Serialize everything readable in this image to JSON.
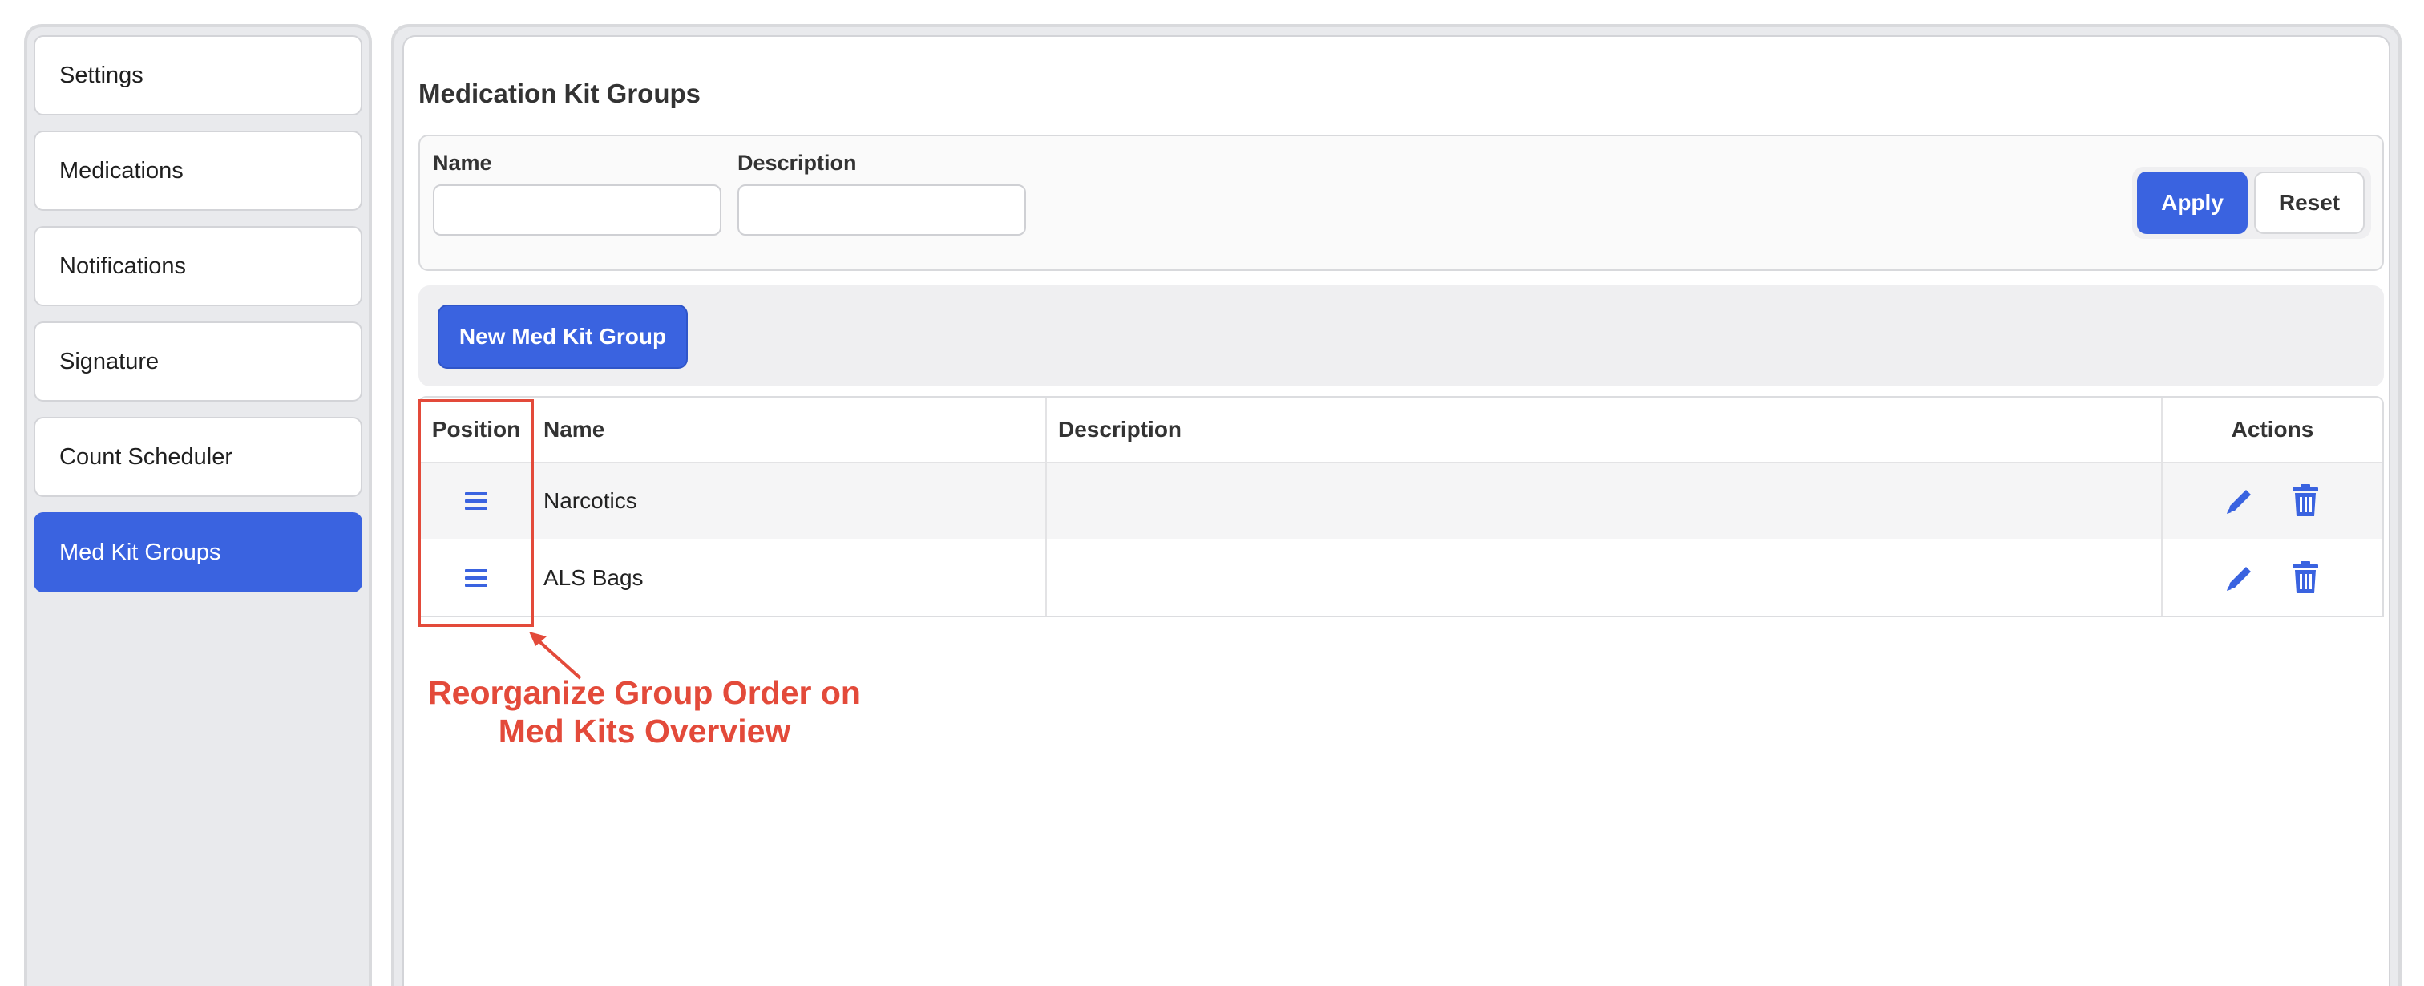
{
  "sidebar": {
    "items": [
      {
        "label": "Settings",
        "active": false
      },
      {
        "label": "Medications",
        "active": false
      },
      {
        "label": "Notifications",
        "active": false
      },
      {
        "label": "Signature",
        "active": false
      },
      {
        "label": "Count Scheduler",
        "active": false
      },
      {
        "label": "Med Kit Groups",
        "active": true
      }
    ]
  },
  "page": {
    "title": "Medication Kit Groups"
  },
  "filters": {
    "name_label": "Name",
    "name_value": "",
    "description_label": "Description",
    "description_value": "",
    "apply_label": "Apply",
    "reset_label": "Reset"
  },
  "toolbar": {
    "new_label": "New Med Kit Group"
  },
  "table": {
    "columns": [
      "Position",
      "Name",
      "Description",
      "Actions"
    ],
    "rows": [
      {
        "name": "Narcotics",
        "description": ""
      },
      {
        "name": "ALS Bags",
        "description": ""
      }
    ]
  },
  "annotation": {
    "line1": "Reorganize Group Order on",
    "line2": "Med Kits Overview"
  },
  "icons": {
    "drag": "drag-handle-icon",
    "edit": "pencil-icon",
    "delete": "trash-icon"
  },
  "colors": {
    "accent": "#3a63e0",
    "annotation": "#e34a3a"
  }
}
